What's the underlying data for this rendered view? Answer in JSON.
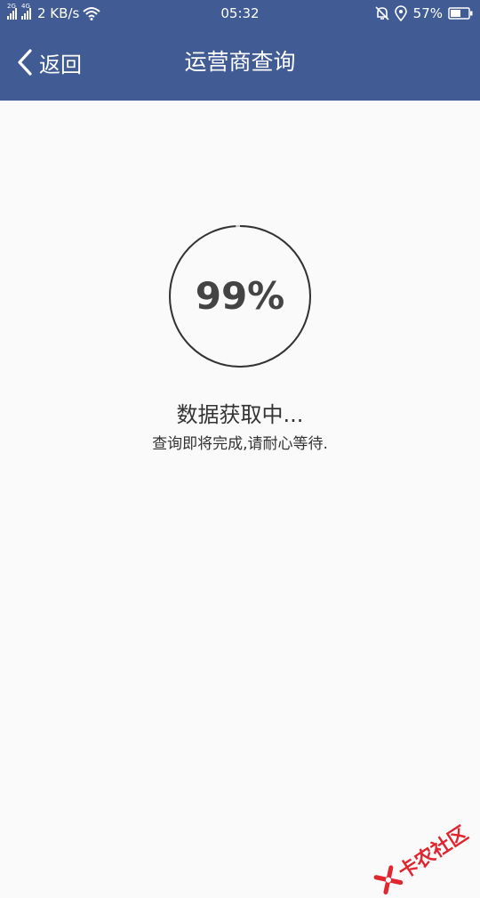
{
  "status_bar": {
    "network_1": "2G",
    "network_2": "4G",
    "speed": "2 KB/s",
    "time": "05:32",
    "battery": "57%"
  },
  "nav": {
    "back_label": "返回",
    "title": "运营商查询"
  },
  "progress": {
    "percent_text": "99%",
    "fraction": 0.99
  },
  "status": {
    "title": "数据获取中...",
    "subtitle": "查询即将完成,请耐心等待."
  },
  "watermark": {
    "text": "卡农社区"
  },
  "colors": {
    "header": "#415b94",
    "background": "#fafafa",
    "ring": "#333333",
    "ring_track": "#cccccc",
    "watermark": "#e0262f"
  }
}
